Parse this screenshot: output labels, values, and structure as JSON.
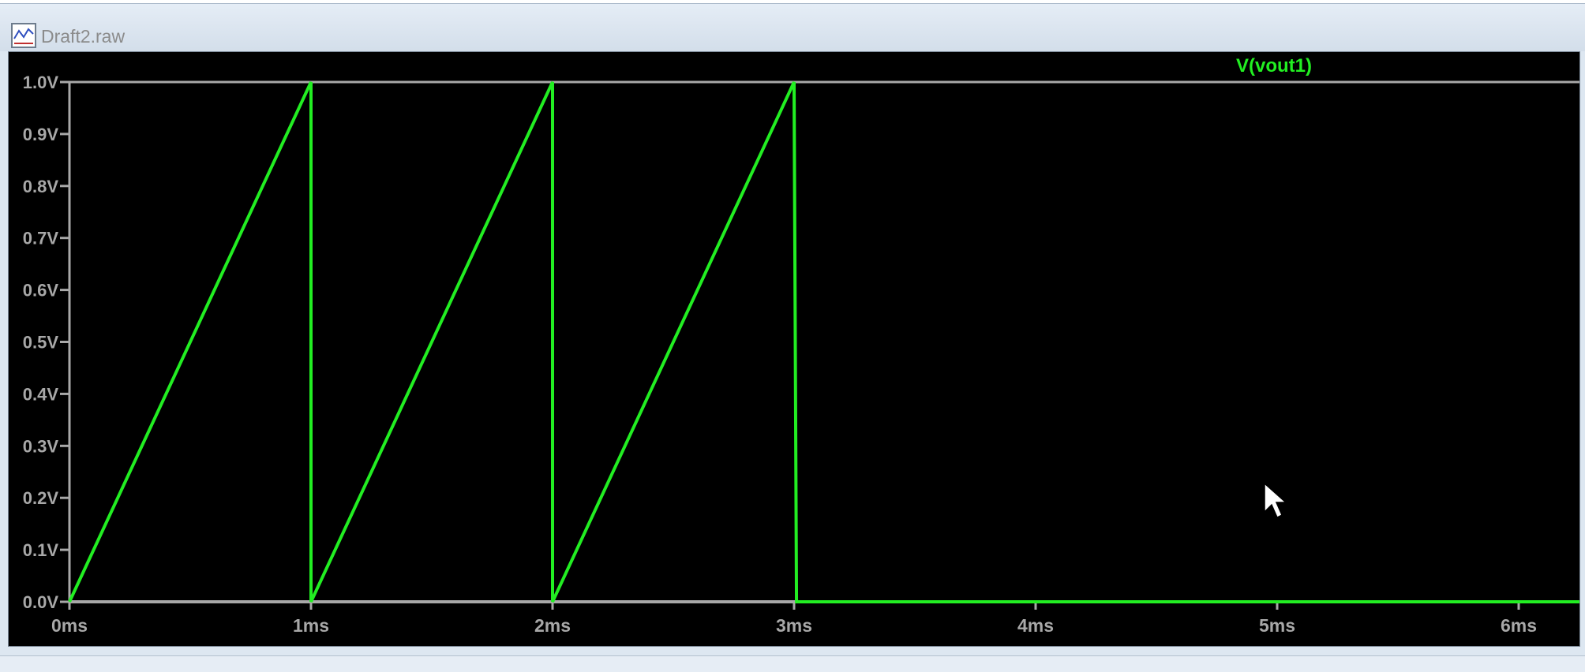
{
  "window": {
    "title": "Draft2.raw",
    "icon": "waveform-viewer-icon"
  },
  "chart_data": {
    "type": "line",
    "title": "",
    "xlabel": "",
    "ylabel": "",
    "xlim": [
      0,
      6.4
    ],
    "ylim": [
      0,
      1.0
    ],
    "grid": false,
    "legend_position": "top",
    "x_ticks": [
      "0ms",
      "1ms",
      "2ms",
      "3ms",
      "4ms",
      "5ms",
      "6ms"
    ],
    "y_ticks": [
      "0.0V",
      "0.1V",
      "0.2V",
      "0.3V",
      "0.4V",
      "0.5V",
      "0.6V",
      "0.7V",
      "0.8V",
      "0.9V",
      "1.0V"
    ],
    "series": [
      {
        "name": "V(vout1)",
        "color": "#22ee22",
        "x": [
          0,
          1.0,
          1.0,
          2.0,
          2.0,
          3.0,
          3.01,
          6.4
        ],
        "y": [
          0,
          1.0,
          0,
          1.0,
          0,
          1.0,
          0,
          0
        ]
      }
    ],
    "axis_color": "#a8a8a8",
    "background_color": "#000000"
  }
}
